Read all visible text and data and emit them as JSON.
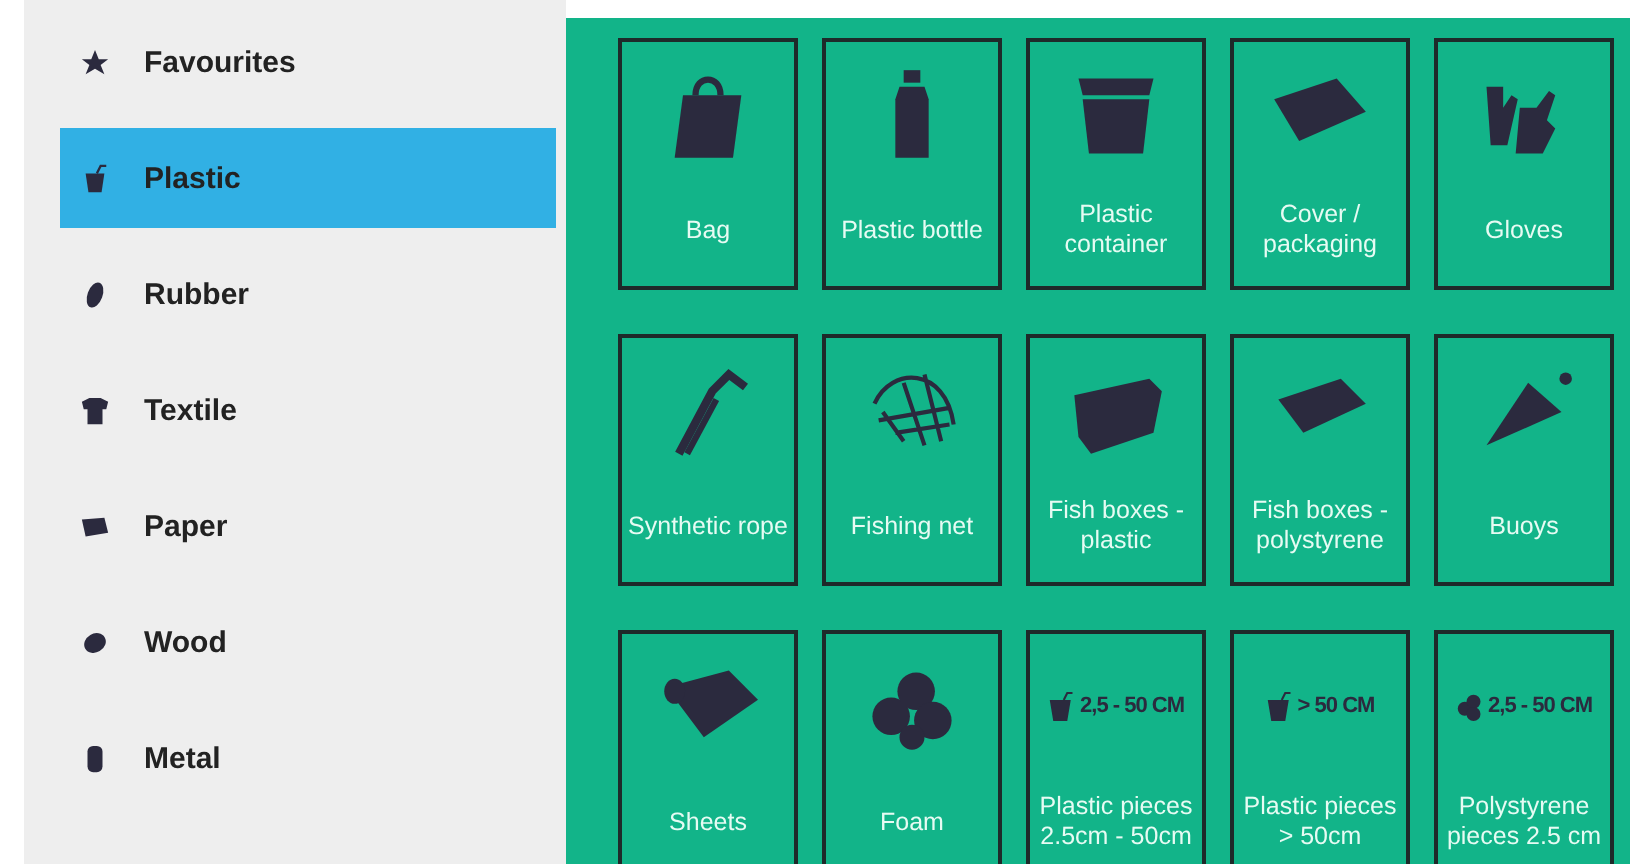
{
  "sidebar": {
    "items": [
      {
        "label": "Favourites",
        "selected": false
      },
      {
        "label": "Plastic",
        "selected": true
      },
      {
        "label": "Rubber",
        "selected": false
      },
      {
        "label": "Textile",
        "selected": false
      },
      {
        "label": "Paper",
        "selected": false
      },
      {
        "label": "Wood",
        "selected": false
      },
      {
        "label": "Metal",
        "selected": false
      }
    ]
  },
  "tiles": [
    {
      "kind": "icon",
      "label": "Bag"
    },
    {
      "kind": "icon",
      "label": "Plastic bottle"
    },
    {
      "kind": "icon",
      "label": "Plastic container"
    },
    {
      "kind": "icon",
      "label": "Cover / packaging"
    },
    {
      "kind": "icon",
      "label": "Gloves"
    },
    {
      "kind": "icon",
      "label": "Synthetic rope"
    },
    {
      "kind": "icon",
      "label": "Fishing net"
    },
    {
      "kind": "icon",
      "label": "Fish boxes - plastic"
    },
    {
      "kind": "icon",
      "label": "Fish boxes - polystyrene"
    },
    {
      "kind": "icon",
      "label": "Buoys"
    },
    {
      "kind": "icon",
      "label": "Sheets"
    },
    {
      "kind": "icon",
      "label": "Foam"
    },
    {
      "kind": "badge",
      "badge": "2,5 - 50 CM",
      "label": "Plastic pieces 2.5cm - 50cm"
    },
    {
      "kind": "badge",
      "badge": "> 50 CM",
      "label": "Plastic pieces > 50cm"
    },
    {
      "kind": "badge",
      "badge": "2,5 - 50 CM",
      "label": "Polystyrene pieces 2.5 cm"
    }
  ]
}
